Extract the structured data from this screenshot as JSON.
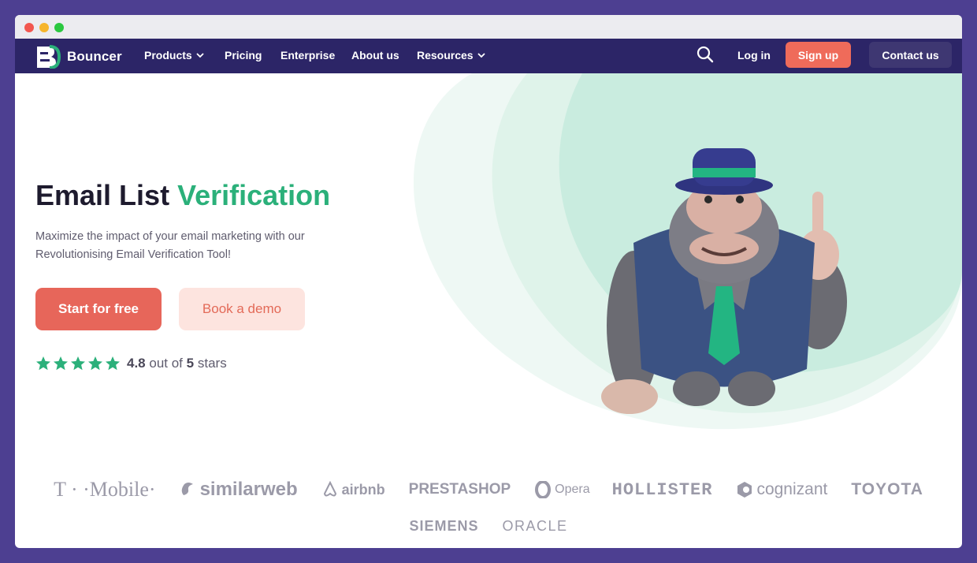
{
  "nav": {
    "logo_text": "Bouncer",
    "items": [
      {
        "label": "Products",
        "dropdown": true
      },
      {
        "label": "Pricing",
        "dropdown": false
      },
      {
        "label": "Enterprise",
        "dropdown": false
      },
      {
        "label": "About us",
        "dropdown": false
      },
      {
        "label": "Resources",
        "dropdown": true
      }
    ],
    "login": "Log in",
    "signup": "Sign up",
    "contact": "Contact us",
    "icons": {
      "search": "search-icon",
      "dropdown": "chevron-down-icon"
    }
  },
  "hero": {
    "headline_part1": "Email List",
    "headline_accent": "Verification",
    "subtext": "Maximize the impact of your email marketing with our Revolutionising Email Verification Tool!",
    "primary_cta": "Start for free",
    "secondary_cta": "Book a demo",
    "rating": {
      "score": "4.8",
      "mid": "out of",
      "max": "5",
      "suffix": "stars",
      "star_count": 5
    },
    "illustration": "gorilla-mascot-in-hat-and-vest"
  },
  "logos": {
    "row1": [
      "T · ·Mobile·",
      "similarweb",
      "airbnb",
      "PRESTASHOP",
      "Opera",
      "HOLLISTER",
      "cognizant",
      "TOYOTA"
    ],
    "row2": [
      "SIEMENS",
      "ORACLE"
    ]
  },
  "colors": {
    "page_bg": "#4d3f91",
    "nav_bg": "#2c2567",
    "accent_green": "#2bb07a",
    "cta_coral": "#e7665a",
    "cta_soft": "#fde4df",
    "mint": "#c9ecdf"
  }
}
